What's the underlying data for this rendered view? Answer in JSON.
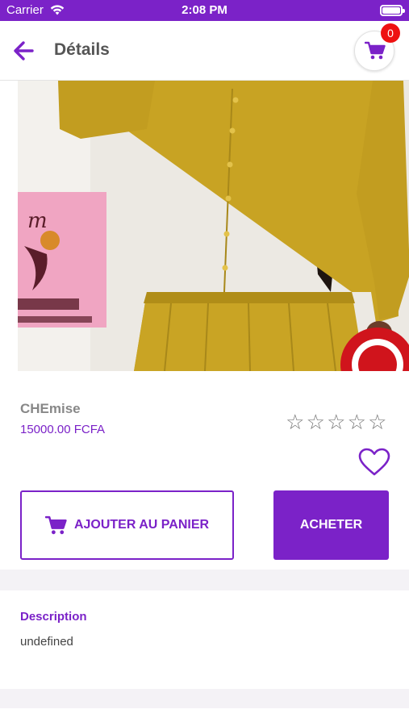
{
  "status_bar": {
    "carrier": "Carrier",
    "time": "2:08 PM"
  },
  "header": {
    "title": "Détails",
    "cart_count": "0"
  },
  "product": {
    "name": "CHEmise",
    "price": "15000.00 FCFA",
    "rating": 0,
    "rating_max": 5,
    "stars": [
      "☆",
      "☆",
      "☆",
      "☆",
      "☆"
    ]
  },
  "actions": {
    "add_to_cart": "AJOUTER AU PANIER",
    "buy": "ACHETER"
  },
  "description": {
    "title": "Description",
    "text": "undefined"
  },
  "colors": {
    "accent": "#7b22c8",
    "badge": "#ee1111",
    "dress": "#c8a323"
  }
}
